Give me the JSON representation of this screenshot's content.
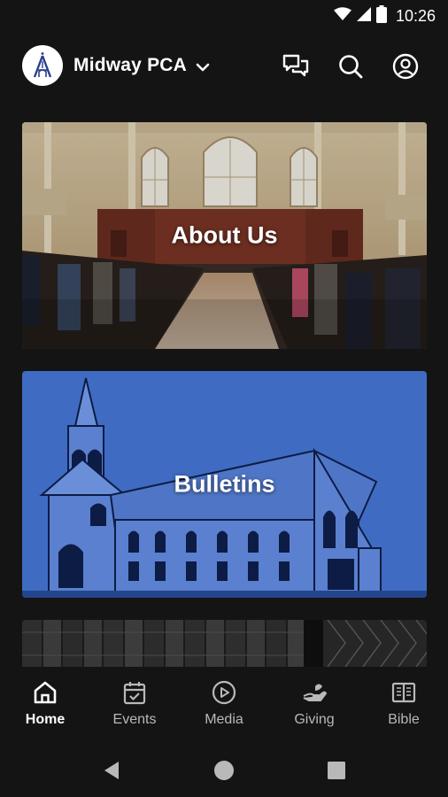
{
  "status_bar": {
    "time": "10:26",
    "icons": [
      "wifi-icon",
      "cell-signal-icon",
      "battery-icon"
    ]
  },
  "header": {
    "title": "Midway PCA",
    "logo_icon": "church-logo",
    "actions": [
      "chat-icon",
      "search-icon",
      "account-icon"
    ]
  },
  "cards": [
    {
      "label": "About Us"
    },
    {
      "label": "Bulletins"
    }
  ],
  "bottom_nav": {
    "items": [
      {
        "label": "Home",
        "icon": "home-icon",
        "active": true
      },
      {
        "label": "Events",
        "icon": "calendar-icon",
        "active": false
      },
      {
        "label": "Media",
        "icon": "play-icon",
        "active": false
      },
      {
        "label": "Giving",
        "icon": "giving-icon",
        "active": false
      },
      {
        "label": "Bible",
        "icon": "book-icon",
        "active": false
      }
    ]
  },
  "colors": {
    "background": "#141414",
    "text": "#ffffff",
    "inactive_nav": "#b9b9b9",
    "bulletins_blue": "#3f6cc2",
    "logo_blue": "#2c3f8c"
  }
}
